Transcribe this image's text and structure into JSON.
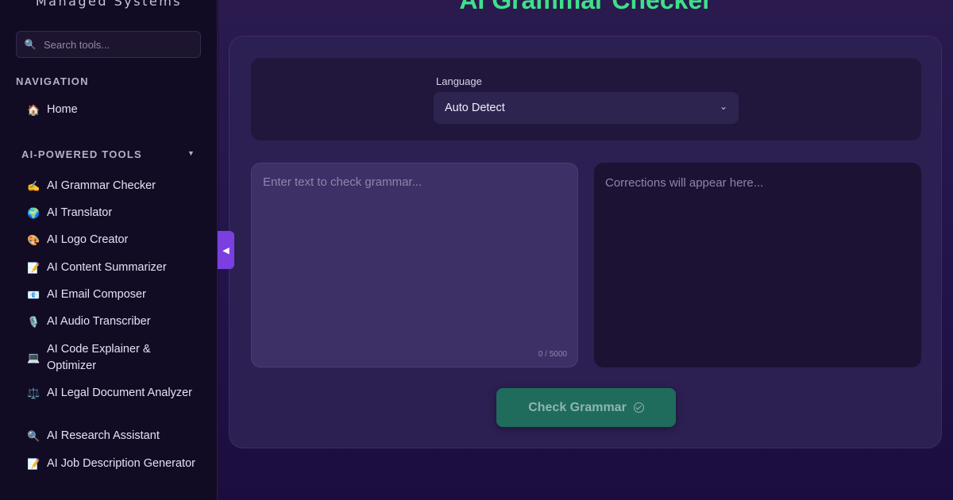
{
  "sidebar": {
    "brand": "Managed Systems",
    "search_placeholder": "Search tools...",
    "search_icon": "🔍",
    "nav_label": "NAVIGATION",
    "home": {
      "icon": "🏠",
      "label": "Home"
    },
    "tools_label": "AI-POWERED TOOLS",
    "tools_caret": "▼",
    "tools": [
      {
        "icon": "✍️",
        "label": "AI Grammar Checker"
      },
      {
        "icon": "🌍",
        "label": "AI Translator"
      },
      {
        "icon": "🎨",
        "label": "AI Logo Creator"
      },
      {
        "icon": "📝",
        "label": "AI Content Summarizer"
      },
      {
        "icon": "📧",
        "label": "AI Email Composer"
      },
      {
        "icon": "🎙️",
        "label": "AI Audio Transcriber"
      },
      {
        "icon": "💻",
        "label": "AI Code Explainer & Optimizer"
      },
      {
        "icon": "⚖️",
        "label": "AI Legal Document Analyzer"
      },
      {
        "icon": "🔍",
        "label": "AI Research Assistant"
      },
      {
        "icon": "📝",
        "label": "AI Job Description Generator"
      }
    ]
  },
  "collapse_glyph": "◀",
  "main": {
    "title": "AI Grammar Checker",
    "language_label": "Language",
    "language_value": "Auto Detect",
    "language_chevron": "⌄",
    "input_placeholder": "Enter text to check grammar...",
    "char_counter": "0 / 5000",
    "output_placeholder": "Corrections will appear here...",
    "check_button": "Check Grammar"
  },
  "colors": {
    "accent_green": "#3ee08a",
    "accent_purple": "#7b3fe0",
    "button_bg": "#1f6b5c"
  }
}
